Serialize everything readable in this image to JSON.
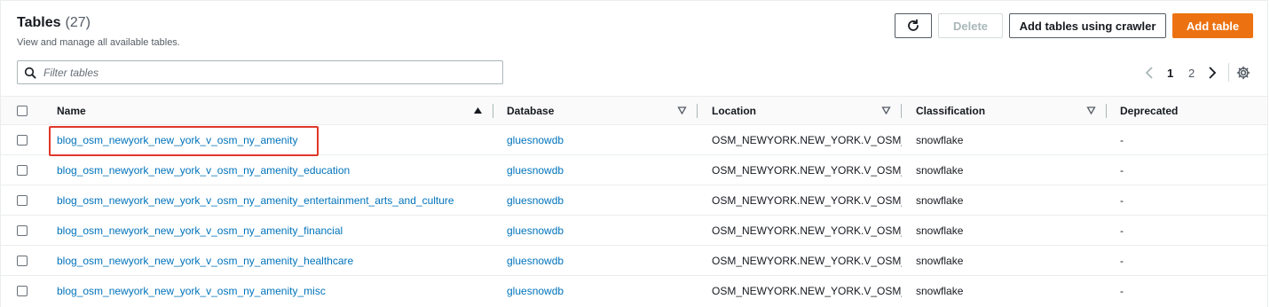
{
  "header": {
    "title": "Tables",
    "count": "(27)",
    "subtitle": "View and manage all available tables."
  },
  "actions": {
    "refresh_icon": "refresh-icon",
    "delete_label": "Delete",
    "crawler_label": "Add tables using crawler",
    "add_label": "Add table",
    "add_color": "#ec7211"
  },
  "search": {
    "placeholder": "Filter tables",
    "value": ""
  },
  "pagination": {
    "current_page": "1",
    "next_page": "2"
  },
  "columns": {
    "name": "Name",
    "database": "Database",
    "location": "Location",
    "classification": "Classification",
    "deprecated": "Deprecated"
  },
  "rows": [
    {
      "name": "blog_osm_newyork_new_york_v_osm_ny_amenity",
      "database": "gluesnowdb",
      "location": "OSM_NEWYORK.NEW_YORK.V_OSM_NY",
      "classification": "snowflake",
      "deprecated": "-"
    },
    {
      "name": "blog_osm_newyork_new_york_v_osm_ny_amenity_education",
      "database": "gluesnowdb",
      "location": "OSM_NEWYORK.NEW_YORK.V_OSM_NY",
      "classification": "snowflake",
      "deprecated": "-"
    },
    {
      "name": "blog_osm_newyork_new_york_v_osm_ny_amenity_entertainment_arts_and_culture",
      "database": "gluesnowdb",
      "location": "OSM_NEWYORK.NEW_YORK.V_OSM_NY",
      "classification": "snowflake",
      "deprecated": "-"
    },
    {
      "name": "blog_osm_newyork_new_york_v_osm_ny_amenity_financial",
      "database": "gluesnowdb",
      "location": "OSM_NEWYORK.NEW_YORK.V_OSM_NY",
      "classification": "snowflake",
      "deprecated": "-"
    },
    {
      "name": "blog_osm_newyork_new_york_v_osm_ny_amenity_healthcare",
      "database": "gluesnowdb",
      "location": "OSM_NEWYORK.NEW_YORK.V_OSM_NY",
      "classification": "snowflake",
      "deprecated": "-"
    },
    {
      "name": "blog_osm_newyork_new_york_v_osm_ny_amenity_misc",
      "database": "gluesnowdb",
      "location": "OSM_NEWYORK.NEW_YORK.V_OSM_NY",
      "classification": "snowflake",
      "deprecated": "-"
    }
  ],
  "highlight_color": "#e0372b"
}
